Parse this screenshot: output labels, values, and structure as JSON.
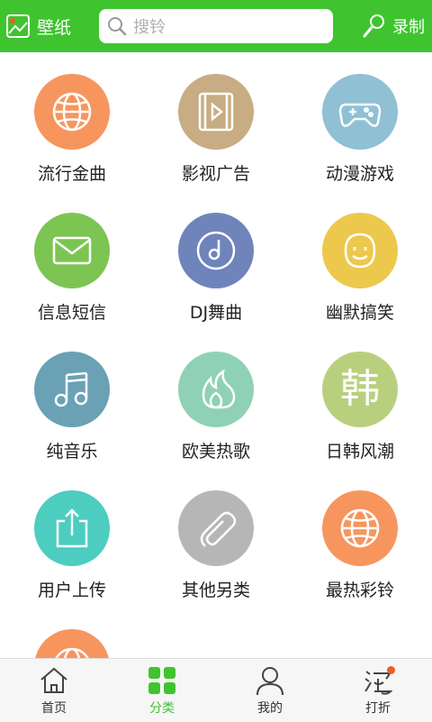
{
  "header": {
    "wallpaper_label": "壁纸",
    "search_placeholder": "搜铃",
    "record_label": "录制"
  },
  "categories": [
    {
      "label": "流行金曲",
      "color": "#f7955e",
      "icon": "globe-icon"
    },
    {
      "label": "影视广告",
      "color": "#c8ac83",
      "icon": "film-icon"
    },
    {
      "label": "动漫游戏",
      "color": "#8fc0d3",
      "icon": "gamepad-icon"
    },
    {
      "label": "信息短信",
      "color": "#7cc552",
      "icon": "envelope-icon"
    },
    {
      "label": "DJ舞曲",
      "color": "#6f84bb",
      "icon": "disc-icon"
    },
    {
      "label": "幽默搞笑",
      "color": "#ecc84d",
      "icon": "smiley-icon"
    },
    {
      "label": "纯音乐",
      "color": "#6aa1b5",
      "icon": "music-note-icon"
    },
    {
      "label": "欧美热歌",
      "color": "#8fd1b6",
      "icon": "flame-icon"
    },
    {
      "label": "日韩风潮",
      "color": "#b8d07e",
      "icon": "korea-character-icon"
    },
    {
      "label": "用户上传",
      "color": "#4ccdc0",
      "icon": "upload-icon"
    },
    {
      "label": "其他另类",
      "color": "#b6b6b6",
      "icon": "paperclip-icon"
    },
    {
      "label": "最热彩铃",
      "color": "#f7955e",
      "icon": "globe-icon"
    },
    {
      "label": "",
      "color": "#f7955e",
      "icon": "globe-icon"
    }
  ],
  "korea_char": "韩",
  "bottom_nav": [
    {
      "label": "首页",
      "icon": "home-icon",
      "active": false
    },
    {
      "label": "分类",
      "icon": "grid-icon",
      "active": true
    },
    {
      "label": "我的",
      "icon": "user-icon",
      "active": false
    },
    {
      "label": "打折",
      "icon": "discount-icon",
      "active": false
    }
  ],
  "colors": {
    "accent": "#3fc42f",
    "badge": "#f25a2a"
  }
}
